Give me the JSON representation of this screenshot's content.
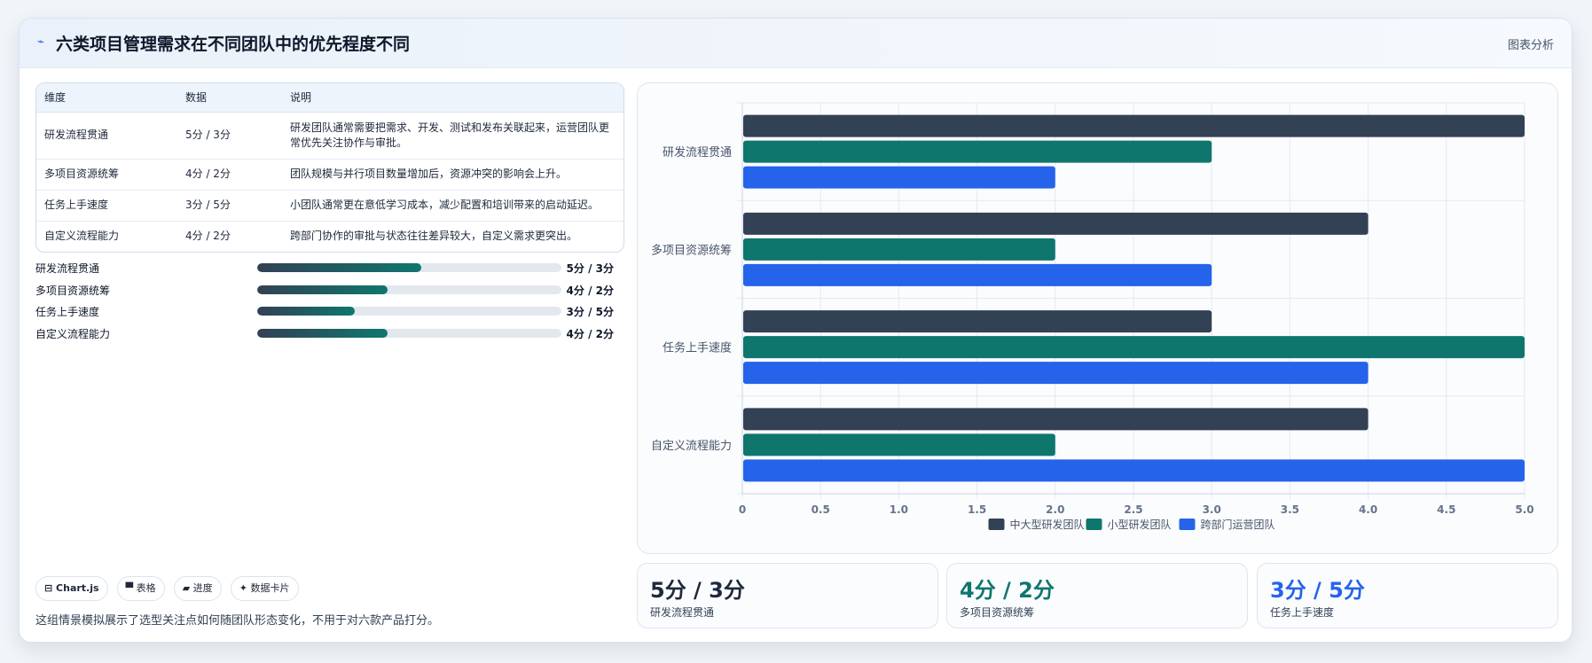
{
  "header": {
    "icon": "trend-icon",
    "title": "六类项目管理需求在不同团队中的优先程度不同",
    "link": "图表分析"
  },
  "table": {
    "columns": [
      "维度",
      "数据",
      "说明"
    ],
    "rows": [
      {
        "dim": "研发流程贯通",
        "data": "5分 / 3分",
        "desc": "研发团队通常需要把需求、开发、测试和发布关联起来，运营团队更常优先关注协作与审批。"
      },
      {
        "dim": "多项目资源统筹",
        "data": "4分 / 2分",
        "desc": "团队规模与并行项目数量增加后，资源冲突的影响会上升。"
      },
      {
        "dim": "任务上手速度",
        "data": "3分 / 5分",
        "desc": "小团队通常更在意低学习成本，减少配置和培训带来的启动延迟。"
      },
      {
        "dim": "自定义流程能力",
        "data": "4分 / 2分",
        "desc": "跨部门协作的审批与状态往往差异较大，自定义需求更突出。"
      }
    ]
  },
  "progress": [
    {
      "label": "研发流程贯通",
      "value": "5分 / 3分",
      "fraction": 0.54
    },
    {
      "label": "多项目资源统筹",
      "value": "4分 / 2分",
      "fraction": 0.43
    },
    {
      "label": "任务上手速度",
      "value": "3分 / 5分",
      "fraction": 0.32
    },
    {
      "label": "自定义流程能力",
      "value": "4分 / 2分",
      "fraction": 0.43
    }
  ],
  "chips": [
    "⊟ Chart.js",
    "▀ 表格",
    "▰ 进度",
    "✦ 数据卡片"
  ],
  "footnote": "这组情景模拟展示了选型关注点如何随团队形态变化，不用于对六款产品打分。",
  "kpis": [
    {
      "value": "5分 / 3分",
      "label": "研发流程贯通",
      "color": "#1e293b"
    },
    {
      "value": "4分 / 2分",
      "label": "多项目资源统筹",
      "color": "#0f766e"
    },
    {
      "value": "3分 / 5分",
      "label": "任务上手速度",
      "color": "#2563eb"
    }
  ],
  "chart_data": {
    "type": "bar",
    "orientation": "horizontal",
    "categories": [
      "研发流程贯通",
      "多项目资源统筹",
      "任务上手速度",
      "自定义流程能力"
    ],
    "series": [
      {
        "name": "中大型研发团队",
        "color": "#334155",
        "values": [
          5,
          4,
          3,
          4
        ]
      },
      {
        "name": "小型研发团队",
        "color": "#0f766e",
        "values": [
          3,
          2,
          5,
          2
        ]
      },
      {
        "name": "跨部门运营团队",
        "color": "#2563eb",
        "values": [
          2,
          3,
          4,
          5
        ]
      }
    ],
    "xlim": [
      0,
      5
    ],
    "xticks": [
      "0",
      "0.5",
      "1.0",
      "1.5",
      "2.0",
      "2.5",
      "3.0",
      "3.5",
      "4.0",
      "4.5",
      "5.0"
    ],
    "grid": true,
    "legend": "bottom"
  }
}
